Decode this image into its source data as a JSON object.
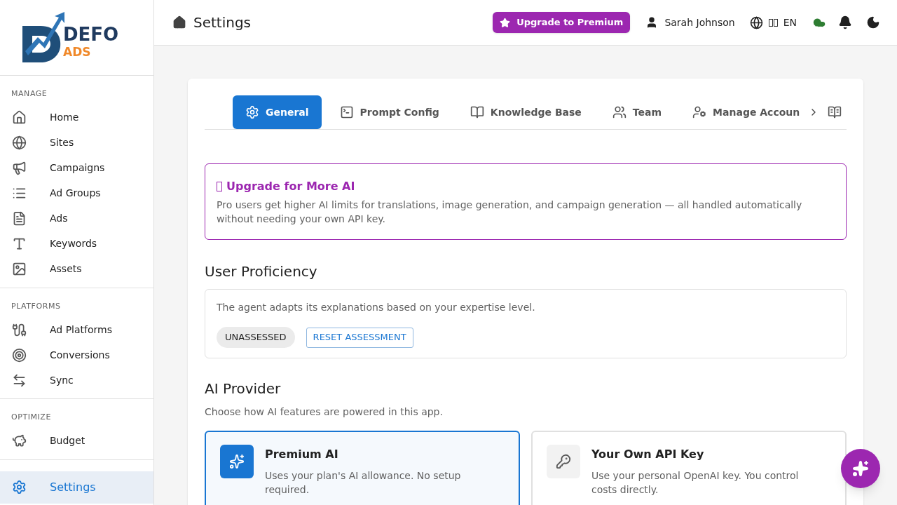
{
  "logo": {
    "word": "DEFO",
    "sub": "ADS"
  },
  "sidebar": {
    "sections": [
      {
        "title": "MANAGE",
        "items": [
          {
            "label": "Home",
            "selected": false
          },
          {
            "label": "Sites",
            "selected": false
          },
          {
            "label": "Campaigns",
            "selected": false
          },
          {
            "label": "Ad Groups",
            "selected": false
          },
          {
            "label": "Ads",
            "selected": false
          },
          {
            "label": "Keywords",
            "selected": false
          },
          {
            "label": "Assets",
            "selected": false
          }
        ]
      },
      {
        "title": "PLATFORMS",
        "items": [
          {
            "label": "Ad Platforms",
            "selected": false
          },
          {
            "label": "Conversions",
            "selected": false
          },
          {
            "label": "Sync",
            "selected": false
          }
        ]
      },
      {
        "title": "OPTIMIZE",
        "items": [
          {
            "label": "Budget",
            "selected": false
          }
        ]
      },
      {
        "items": [
          {
            "label": "Settings",
            "selected": true
          }
        ]
      }
    ]
  },
  "header": {
    "title": "Settings",
    "upgrade": "Upgrade to Premium",
    "user": "Sarah Johnson",
    "language": "EN"
  },
  "tabs": [
    {
      "label": "General",
      "selected": true
    },
    {
      "label": "Prompt Config",
      "selected": false
    },
    {
      "label": "Knowledge Base",
      "selected": false
    },
    {
      "label": "Team",
      "selected": false
    },
    {
      "label": "Manage Accoun",
      "selected": false
    }
  ],
  "upgrade_banner": {
    "title": "Upgrade for More AI",
    "text": "Pro users get higher AI limits for translations, image generation, and campaign generation — all handled automatically without needing your own API key."
  },
  "proficiency": {
    "heading": "User Proficiency",
    "text": "The agent adapts its explanations based on your expertise level.",
    "level": "UNASSESSED",
    "reset": "RESET ASSESSMENT"
  },
  "ai_provider": {
    "heading": "AI Provider",
    "text": "Choose how AI features are powered in this app.",
    "options": [
      {
        "title": "Premium AI",
        "text": "Uses your plan's AI allowance. No setup required.",
        "selected": true
      },
      {
        "title": "Your Own API Key",
        "text": "Use your personal OpenAI key. You control costs directly.",
        "selected": false
      }
    ]
  }
}
